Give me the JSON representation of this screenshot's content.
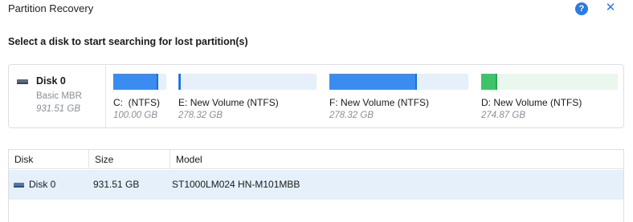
{
  "window": {
    "title": "Partition Recovery",
    "help_label": "?",
    "close_label": "✕"
  },
  "heading": "Select a disk to start searching for lost partition(s)",
  "disk": {
    "name": "Disk 0",
    "type": "Basic MBR",
    "size": "931.51 GB",
    "icon": "disk-drive-icon"
  },
  "partitions": [
    {
      "letter": "C:",
      "label": "(NTFS)",
      "size": "100.00 GB",
      "used_fraction": 0.85,
      "color": "#3b8cf0"
    },
    {
      "letter": "E:",
      "label": "New Volume (NTFS)",
      "size": "278.32 GB",
      "used_fraction": 0.02,
      "color": "#3b8cf0"
    },
    {
      "letter": "F:",
      "label": "New Volume (NTFS)",
      "size": "278.32 GB",
      "used_fraction": 0.63,
      "color": "#3b8cf0"
    },
    {
      "letter": "D:",
      "label": "New Volume (NTFS)",
      "size": "274.87 GB",
      "used_fraction": 0.12,
      "color": "#3fc36a"
    }
  ],
  "table": {
    "columns": [
      "Disk",
      "Size",
      "Model"
    ],
    "rows": [
      {
        "disk": "Disk 0",
        "size": "931.51 GB",
        "model": "ST1000LM024 HN-M101MBB"
      }
    ]
  },
  "colors": {
    "accent": "#2a7ae2",
    "selected_row": "#e5f0fb"
  }
}
